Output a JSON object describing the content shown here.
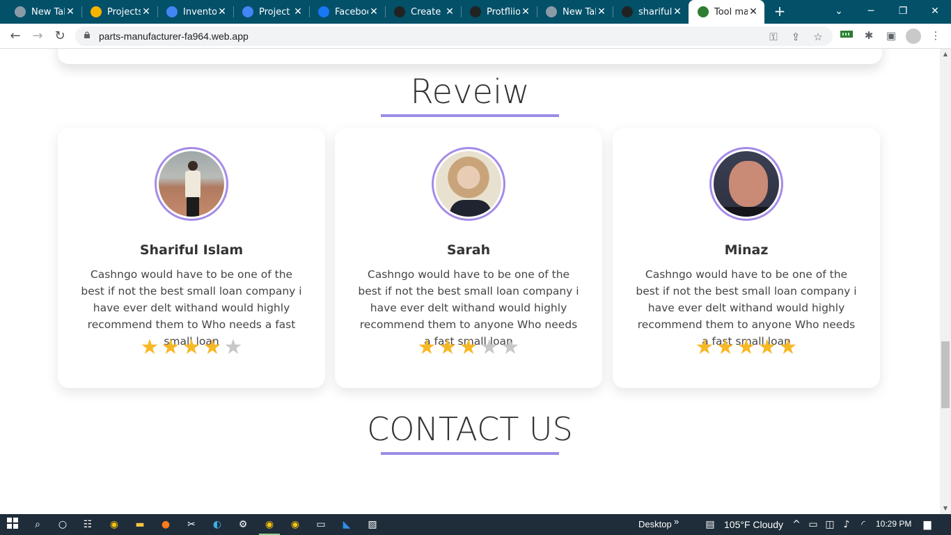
{
  "browser": {
    "tabs": [
      {
        "title": "New Tab",
        "icon": "chrome-icon",
        "color": "#8a9ba8"
      },
      {
        "title": "Projects",
        "icon": "google-drive-icon",
        "color": "#f4b400"
      },
      {
        "title": "Inventory",
        "icon": "google-docs-icon",
        "color": "#4285f4"
      },
      {
        "title": "Project r",
        "icon": "google-docs-icon",
        "color": "#4285f4"
      },
      {
        "title": "Faceboo",
        "icon": "facebook-icon",
        "color": "#1877f2"
      },
      {
        "title": "Create a",
        "icon": "react-icon",
        "color": "#222"
      },
      {
        "title": "Protfliio",
        "icon": "react-icon",
        "color": "#222"
      },
      {
        "title": "New Tab",
        "icon": "chrome-icon",
        "color": "#8a9ba8"
      },
      {
        "title": "shariful",
        "icon": "github-icon",
        "color": "#222"
      },
      {
        "title": "Tool ma",
        "icon": "tool-icon",
        "color": "#2e7d32",
        "active": true
      }
    ],
    "url": "parts-manufacturer-fa964.web.app"
  },
  "page": {
    "review_title": "Reveiw",
    "contact_title": "CONTACT US",
    "reviews": [
      {
        "name": "Shariful Islam",
        "text": "Cashngo would have to be one of the best if not the best small loan company i have ever delt withand would highly recommend them to Who needs a fast small loan",
        "rating": 4,
        "max_rating": 5
      },
      {
        "name": "Sarah",
        "text": "Cashngo would have to be one of the best if not the best small loan company i have ever delt withand would highly recommend them to anyone Who needs a fast small loan",
        "rating": 3,
        "max_rating": 5
      },
      {
        "name": "Minaz",
        "text": "Cashngo would have to be one of the best if not the best small loan company i have ever delt withand would highly recommend them to anyone Who needs a fast small loan",
        "rating": 5,
        "max_rating": 5
      }
    ]
  },
  "taskbar": {
    "desktop_label": "Desktop",
    "weather": "105°F  Cloudy",
    "time": "10:29 PM"
  },
  "colors": {
    "accent_underline": "#9b8de6",
    "star_on": "#f7b825",
    "star_off": "#c8c8c8",
    "tabstrip": "#035069"
  }
}
